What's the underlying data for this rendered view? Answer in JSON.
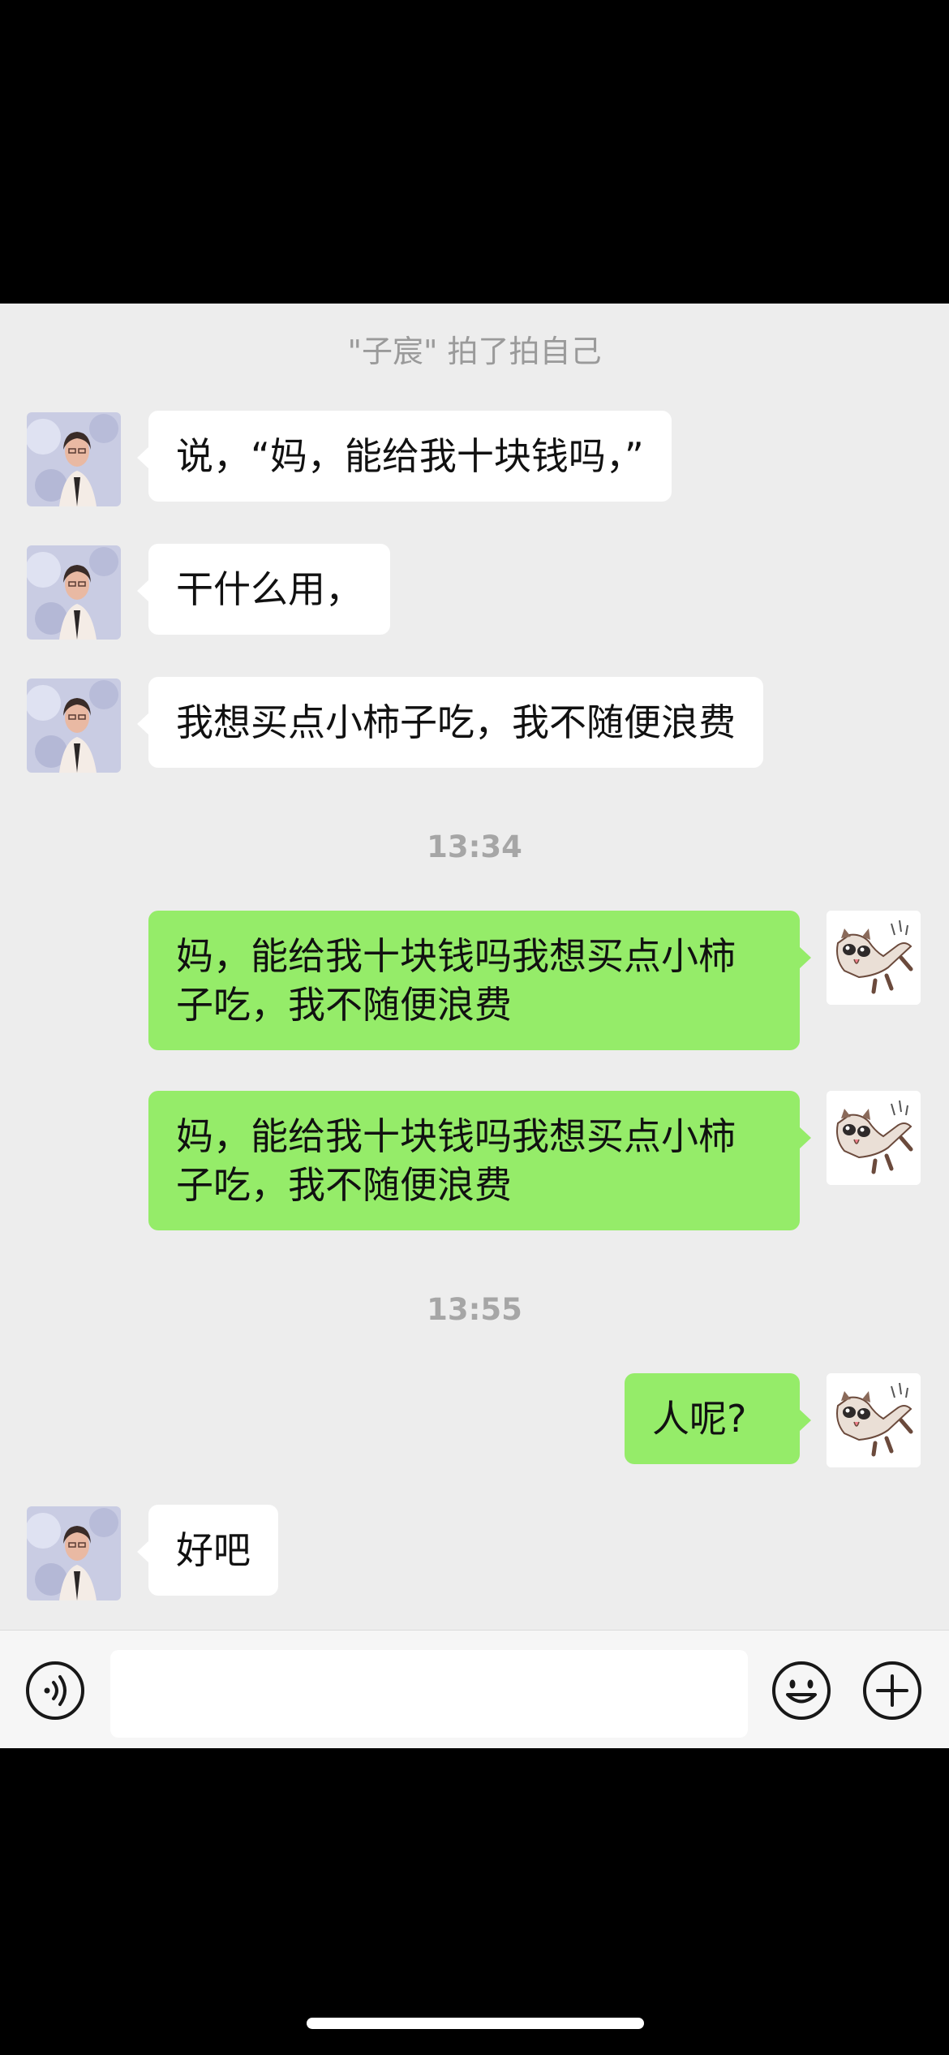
{
  "chat": {
    "system_notice": "\"子宸\" 拍了拍自己",
    "messages": [
      {
        "sender": "mother",
        "text": "说，“妈，能给我十块钱吗，”"
      },
      {
        "sender": "mother",
        "text": "干什么用，"
      },
      {
        "sender": "mother",
        "text": "我想买点小柿子吃，我不随便浪费"
      },
      {
        "sender": "self",
        "text": "妈，能给我十块钱吗我想买点小柿子吃，我不随便浪费"
      },
      {
        "sender": "self",
        "text": "妈，能给我十块钱吗我想买点小柿子吃，我不随便浪费"
      },
      {
        "sender": "self",
        "text": "人呢?"
      },
      {
        "sender": "mother",
        "text": "好吧"
      }
    ],
    "timestamps": [
      "13:34",
      "13:55"
    ]
  },
  "input_bar": {
    "voice_icon": "voice-icon",
    "emoji_icon": "emoji-icon",
    "plus_icon": "plus-icon",
    "text_value": ""
  },
  "colors": {
    "chat_bg": "#ededed",
    "incoming_bubble": "#ffffff",
    "outgoing_bubble": "#95ec69",
    "input_bar_bg": "#f6f6f6"
  }
}
